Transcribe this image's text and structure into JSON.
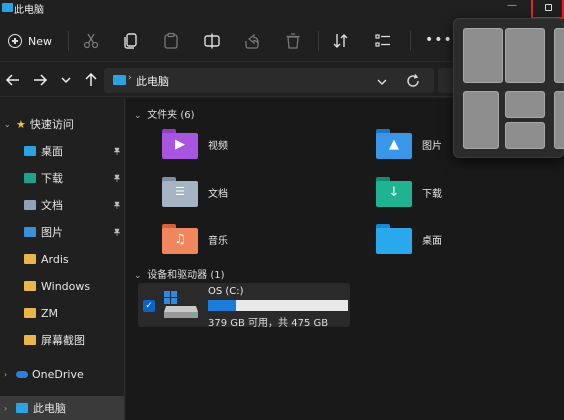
{
  "window": {
    "title": "此电脑"
  },
  "titlebar": {
    "minimize_glyph": "—"
  },
  "toolbar": {
    "new_label": "New",
    "icons": [
      "cut-icon",
      "copy-icon",
      "paste-icon",
      "rename-icon",
      "share-icon",
      "delete-icon",
      "sort-icon",
      "view-icon"
    ],
    "more_glyph": "•••"
  },
  "address": {
    "path_label": "此电脑"
  },
  "sidebar": {
    "quick_access_label": "快速访问",
    "items": [
      {
        "label": "桌面",
        "pinned": true,
        "icon": "desktop-icon"
      },
      {
        "label": "下载",
        "pinned": true,
        "icon": "downloads-icon"
      },
      {
        "label": "文档",
        "pinned": true,
        "icon": "documents-icon"
      },
      {
        "label": "图片",
        "pinned": true,
        "icon": "pictures-icon"
      },
      {
        "label": "Ardis",
        "pinned": false,
        "icon": "folder-icon"
      },
      {
        "label": "Windows",
        "pinned": false,
        "icon": "folder-icon"
      },
      {
        "label": "ZM",
        "pinned": false,
        "icon": "folder-icon"
      },
      {
        "label": "屏幕截图",
        "pinned": false,
        "icon": "folder-icon"
      }
    ],
    "onedrive_label": "OneDrive",
    "thispc_label": "此电脑"
  },
  "main": {
    "folders_header": "文件夹 (6)",
    "folders": [
      {
        "label": "视频",
        "icon": "videos-icon"
      },
      {
        "label": "图片",
        "icon": "pictures-icon"
      },
      {
        "label": "文档",
        "icon": "documents-icon"
      },
      {
        "label": "下载",
        "icon": "downloads-icon"
      },
      {
        "label": "音乐",
        "icon": "music-icon"
      },
      {
        "label": "桌面",
        "icon": "desktop-icon"
      }
    ],
    "drives_header": "设备和驱动器 (1)",
    "drive": {
      "name": "OS (C:)",
      "info": "379 GB 可用，共 475 GB",
      "used_fraction": 0.2
    }
  },
  "colors": {
    "accent": "#1b7dd8",
    "highlight_border": "#e0262b",
    "background": "#202020"
  }
}
